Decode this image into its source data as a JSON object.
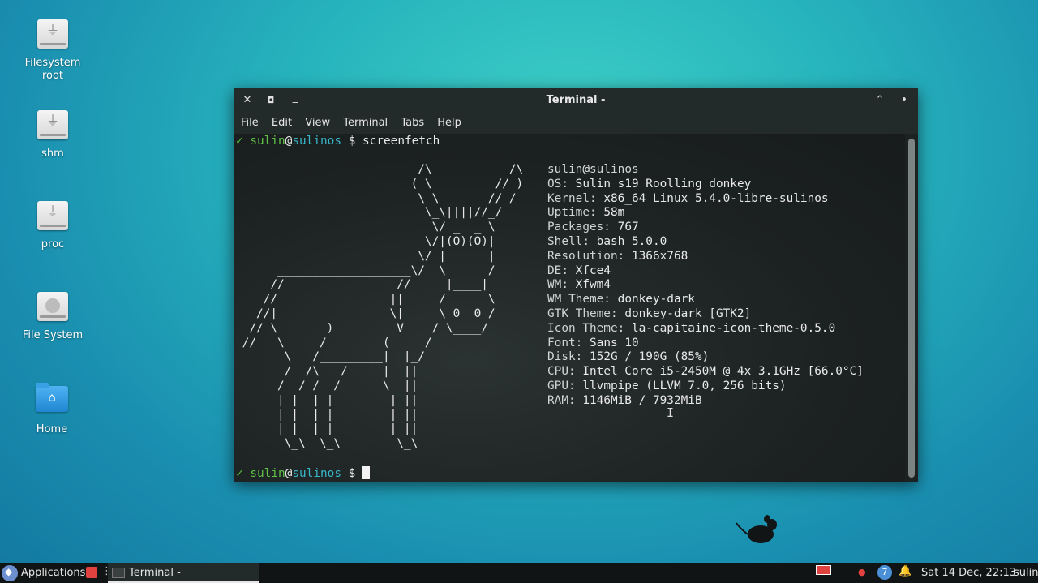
{
  "desktop": {
    "icons": [
      {
        "label": "Filesystem\nroot",
        "icon": "usb-drive-icon"
      },
      {
        "label": "shm",
        "icon": "usb-drive-icon"
      },
      {
        "label": "proc",
        "icon": "usb-drive-icon"
      },
      {
        "label": "File System",
        "icon": "hard-disk-icon"
      },
      {
        "label": "Home",
        "icon": "home-folder-icon"
      }
    ]
  },
  "window": {
    "title": "Terminal -",
    "buttons": {
      "close": "✕",
      "maximize": "◘",
      "minimize": "_",
      "shade": "⌃",
      "menu": "•"
    },
    "menu": [
      "File",
      "Edit",
      "View",
      "Terminal",
      "Tabs",
      "Help"
    ]
  },
  "terminal": {
    "prompt": {
      "check": "✓",
      "user": "sulin",
      "at": "@",
      "host": "sulinos",
      "symbol": "$"
    },
    "command": "screenfetch",
    "ascii_art": "                          /\\           /\\\n                         ( \\         // )\n                          \\ \\       // /\n                           \\_\\||||//_/\n                            \\/ _  _ \\\n                           \\/|(O)(O)|\n                          \\/ |      |\n      ___________________\\/  \\      /\n     //                //     |____|\n    //                ||     /      \\\n   //|                \\|     \\ 0  0 /\n  // \\       )         V    / \\____/\n //   \\     /        (     /\n       \\   /_________|  |_/\n       /  /\\   /     |  ||\n      /  / /  /      \\  ||\n      | |  | |        | ||\n      | |  | |        | ||\n      |_|  |_|        |_||\n       \\_\\  \\_\\        \\_\\",
    "info_user": "sulin",
    "info_at": "@",
    "info_host": "sulinos",
    "info": [
      {
        "key": "OS:",
        "value": "Sulin s19 Roolling donkey"
      },
      {
        "key": "Kernel:",
        "value": "x86_64 Linux 5.4.0-libre-sulinos"
      },
      {
        "key": "Uptime:",
        "value": "58m"
      },
      {
        "key": "Packages:",
        "value": "767"
      },
      {
        "key": "Shell:",
        "value": "bash 5.0.0"
      },
      {
        "key": "Resolution:",
        "value": "1366x768"
      },
      {
        "key": "DE:",
        "value": "Xfce4"
      },
      {
        "key": "WM:",
        "value": "Xfwm4"
      },
      {
        "key": "WM Theme:",
        "value": "donkey-dark"
      },
      {
        "key": "GTK Theme:",
        "value": "donkey-dark [GTK2]"
      },
      {
        "key": "Icon Theme:",
        "value": "la-capitaine-icon-theme-0.5.0"
      },
      {
        "key": "Font:",
        "value": "Sans 10"
      },
      {
        "key": "Disk:",
        "value": "152G / 190G (85%)"
      },
      {
        "key": "CPU:",
        "value": "Intel Core i5-2450M @ 4x 3.1GHz [66.0°C]"
      },
      {
        "key": "GPU:",
        "value": "llvmpipe (LLVM 7.0, 256 bits)"
      },
      {
        "key": "RAM:",
        "value": "1146MiB / 7932MiB"
      }
    ]
  },
  "panel": {
    "applications_label": "Applications",
    "task_label": "Terminal -",
    "notification_count": "7",
    "clock": "Sat 14 Dec, 22:13",
    "user": "sulin"
  }
}
